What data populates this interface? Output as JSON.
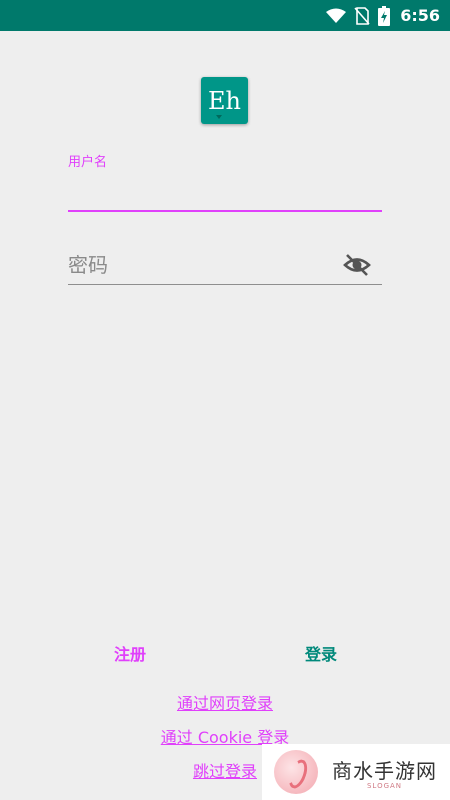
{
  "status_bar": {
    "time": "6:56",
    "icons": [
      "wifi-icon",
      "no-sim-icon",
      "battery-charging-icon"
    ]
  },
  "app": {
    "logo_text": "Eh"
  },
  "form": {
    "username_label": "用户名",
    "username_value": "",
    "password_placeholder": "密码",
    "password_value": ""
  },
  "actions": {
    "register_label": "注册",
    "login_label": "登录"
  },
  "links": {
    "web_login": "通过网页登录",
    "cookie_login": "通过 Cookie 登录",
    "skip_login": "跳过登录"
  },
  "watermark": {
    "title": "商水手游网",
    "subtitle": "SLOGAN"
  },
  "colors": {
    "accent": "#e040fb",
    "primary": "#009688",
    "status_bar": "#00796b",
    "background": "#eeeeee"
  }
}
